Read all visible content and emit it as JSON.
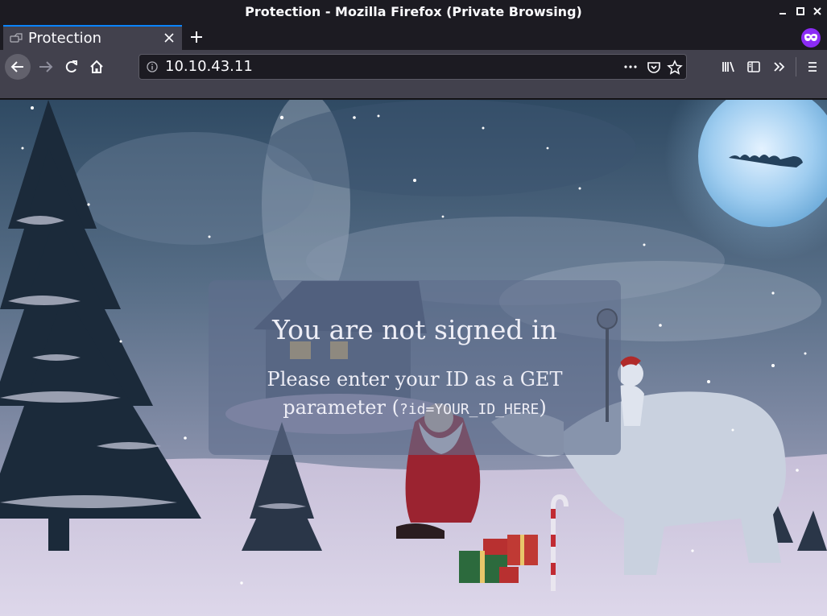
{
  "window": {
    "title": "Protection - Mozilla Firefox (Private Browsing)"
  },
  "tab": {
    "label": "Protection"
  },
  "urlbar": {
    "url": "10.10.43.11"
  },
  "page": {
    "heading": "You are not signed in",
    "line1": "Please enter your ID as a GET",
    "line2_prefix": "parameter (",
    "line2_code": "?id=YOUR_ID_HERE",
    "line2_suffix": ")"
  },
  "colors": {
    "accent": "#0a84ff",
    "private": "#8b2bf5",
    "toolbar": "#42414d",
    "frame": "#1c1b22"
  }
}
